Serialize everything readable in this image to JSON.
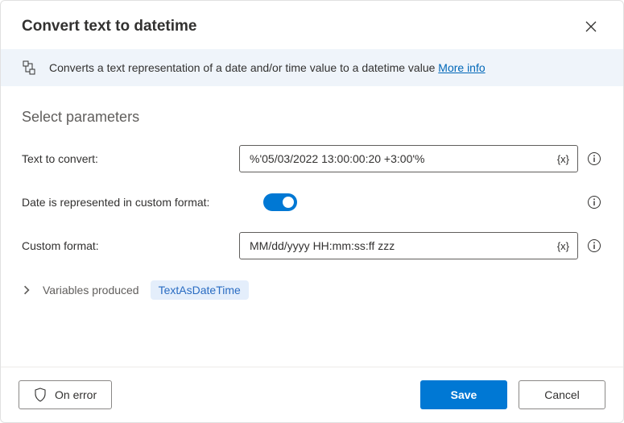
{
  "dialog": {
    "title": "Convert text to datetime",
    "banner_text": "Converts a text representation of a date and/or time value to a datetime value ",
    "banner_link": "More info"
  },
  "section": {
    "heading": "Select parameters"
  },
  "fields": {
    "text_to_convert": {
      "label": "Text to convert:",
      "value": "%'05/03/2022 13:00:00:20 +3:00'%"
    },
    "custom_fmt_toggle": {
      "label": "Date is represented in custom format:",
      "on": true
    },
    "custom_format": {
      "label": "Custom format:",
      "value": "MM/dd/yyyy HH:mm:ss:ff zzz"
    }
  },
  "variables": {
    "label": "Variables produced",
    "chip": "TextAsDateTime"
  },
  "footer": {
    "on_error": "On error",
    "save": "Save",
    "cancel": "Cancel"
  },
  "glyphs": {
    "var_token": "{x}"
  }
}
